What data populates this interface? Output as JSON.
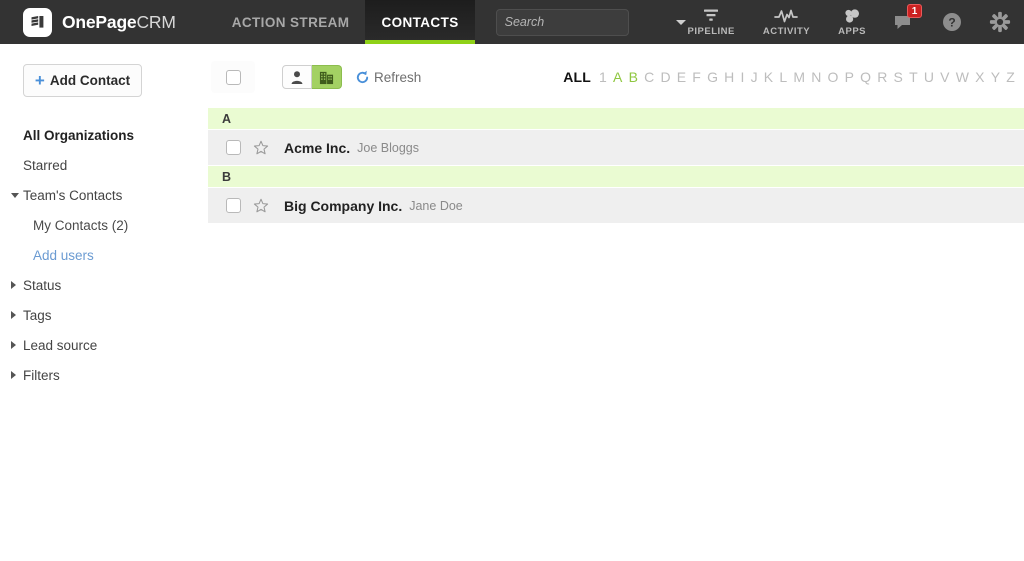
{
  "header": {
    "brand_bold": "OnePage",
    "brand_thin": "CRM",
    "nav": [
      {
        "label": "ACTION STREAM",
        "active": false
      },
      {
        "label": "CONTACTS",
        "active": true
      }
    ],
    "search": {
      "value": "",
      "placeholder": "Search"
    },
    "tools": [
      {
        "label": "PIPELINE",
        "icon": "funnel-icon"
      },
      {
        "label": "ACTIVITY",
        "icon": "activity-pulse-icon"
      },
      {
        "label": "APPS",
        "icon": "apps-icon"
      }
    ],
    "notifications": {
      "icon": "speech-bubble-icon",
      "badge": "1"
    },
    "help": {
      "icon": "help-question-icon"
    },
    "settings": {
      "icon": "gear-icon"
    }
  },
  "sidebar": {
    "add_button": {
      "label": "Add Contact",
      "icon": "plus-icon"
    },
    "items": [
      {
        "label": "All Organizations",
        "style": "head",
        "marker": "none"
      },
      {
        "label": "Starred",
        "style": "plain",
        "marker": "none"
      },
      {
        "label": "Team's Contacts",
        "style": "plain",
        "marker": "down"
      },
      {
        "label": "My Contacts (2)",
        "style": "sub",
        "marker": "none"
      },
      {
        "label": "Add users",
        "style": "link",
        "marker": "none"
      },
      {
        "label": "Status",
        "style": "plain",
        "marker": "right"
      },
      {
        "label": "Tags",
        "style": "plain",
        "marker": "right"
      },
      {
        "label": "Lead source",
        "style": "plain",
        "marker": "right"
      },
      {
        "label": "Filters",
        "style": "plain",
        "marker": "right"
      }
    ]
  },
  "toolbar": {
    "select_all": {
      "checked": false
    },
    "view_people": {
      "icon": "person-icon",
      "active": false
    },
    "view_companies": {
      "icon": "building-icon",
      "active": true
    },
    "refresh": {
      "label": "Refresh",
      "icon": "refresh-circular-arrow-icon"
    },
    "alphabet": [
      {
        "label": "ALL",
        "state": "all"
      },
      {
        "label": "1",
        "state": "dim"
      },
      {
        "label": "A",
        "state": "act"
      },
      {
        "label": "B",
        "state": "act"
      },
      {
        "label": "C",
        "state": "dim"
      },
      {
        "label": "D",
        "state": "dim"
      },
      {
        "label": "E",
        "state": "dim"
      },
      {
        "label": "F",
        "state": "dim"
      },
      {
        "label": "G",
        "state": "dim"
      },
      {
        "label": "H",
        "state": "dim"
      },
      {
        "label": "I",
        "state": "dim"
      },
      {
        "label": "J",
        "state": "dim"
      },
      {
        "label": "K",
        "state": "dim"
      },
      {
        "label": "L",
        "state": "dim"
      },
      {
        "label": "M",
        "state": "dim"
      },
      {
        "label": "N",
        "state": "dim"
      },
      {
        "label": "O",
        "state": "dim"
      },
      {
        "label": "P",
        "state": "dim"
      },
      {
        "label": "Q",
        "state": "dim"
      },
      {
        "label": "R",
        "state": "dim"
      },
      {
        "label": "S",
        "state": "dim"
      },
      {
        "label": "T",
        "state": "dim"
      },
      {
        "label": "U",
        "state": "dim"
      },
      {
        "label": "V",
        "state": "dim"
      },
      {
        "label": "W",
        "state": "dim"
      },
      {
        "label": "X",
        "state": "dim"
      },
      {
        "label": "Y",
        "state": "dim"
      },
      {
        "label": "Z",
        "state": "dim"
      }
    ]
  },
  "list": {
    "groups": [
      {
        "letter": "A",
        "rows": [
          {
            "organization": "Acme Inc.",
            "person": "Joe Bloggs",
            "starred": false,
            "checked": false
          }
        ]
      },
      {
        "letter": "B",
        "rows": [
          {
            "organization": "Big Company Inc.",
            "person": "Jane Doe",
            "starred": false,
            "checked": false
          }
        ]
      }
    ]
  },
  "colors": {
    "header_bg": "#333333",
    "accent_green": "#8fd117",
    "group_header_bg": "#eafbd2",
    "row_bg": "#efefef",
    "toggle_active": "#a3d163",
    "link_blue": "#4a90d9",
    "badge_red": "#cc2222"
  }
}
